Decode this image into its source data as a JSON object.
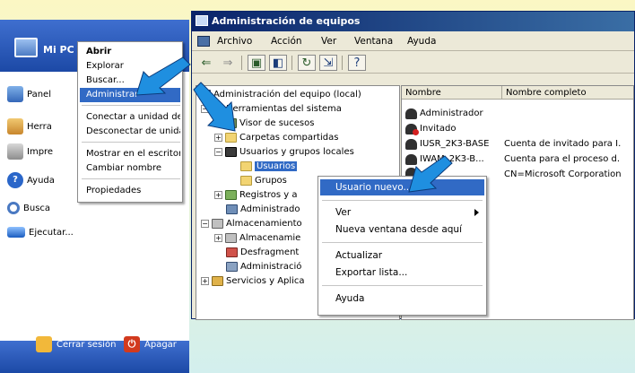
{
  "start_menu": {
    "user_label": "Mi PC",
    "items": [
      {
        "label": "Panel",
        "icon": "control-panel-icon"
      },
      {
        "label": "Herra",
        "icon": "tools-icon"
      },
      {
        "label": "Impre",
        "icon": "printer-icon"
      },
      {
        "label": "Ayuda",
        "icon": "help-icon"
      },
      {
        "label": "Busca",
        "icon": "search-icon"
      },
      {
        "label": "Ejecutar...",
        "icon": "run-icon"
      }
    ],
    "logoff_label": "Cerrar sesión",
    "shutdown_label": "Apagar"
  },
  "desktop_context_menu": {
    "items": [
      {
        "label": "Abrir",
        "bold": true
      },
      {
        "label": "Explorar"
      },
      {
        "label": "Buscar..."
      },
      {
        "label": "Administrar",
        "selected": true
      },
      {
        "label": "Conectar a unidad de red"
      },
      {
        "label": "Desconectar de unidad"
      },
      {
        "label": "Mostrar en el escritorio"
      },
      {
        "label": "Cambiar nombre"
      },
      {
        "label": "Propiedades"
      }
    ]
  },
  "window": {
    "title": "Administración de equipos",
    "menu": [
      "Archivo",
      "Acción",
      "Ver",
      "Ventana",
      "Ayuda"
    ],
    "toolbar": [
      "back-icon",
      "forward-icon",
      "up-folder-icon",
      "show-tree-icon",
      "refresh-icon",
      "export-icon",
      "help-icon"
    ],
    "tree": {
      "root": "Administración del equipo (local)",
      "system_tools": "Herramientas del sistema",
      "event_viewer": "Visor de sucesos",
      "shared_folders": "Carpetas compartidas",
      "local_users": "Usuarios y grupos locales",
      "users": "Usuarios",
      "groups": "Grupos",
      "logs": "Registros y a",
      "device_manager": "Administrado",
      "storage": "Almacenamiento",
      "removable_storage": "Almacenamie",
      "defrag": "Desfragment",
      "disk_mgmt": "Administració",
      "services": "Servicios y Aplica"
    },
    "list": {
      "columns": [
        "Nombre",
        "Nombre completo"
      ],
      "rows": [
        {
          "name": "Administrador",
          "full": "",
          "disabled": false
        },
        {
          "name": "Invitado",
          "full": "",
          "disabled": true
        },
        {
          "name": "IUSR_2K3-BASE",
          "full": "Cuenta de invitado para I.",
          "disabled": false
        },
        {
          "name": "IWAM_2K3-B...",
          "full": "Cuenta para el proceso d.",
          "disabled": false
        },
        {
          "name": "",
          "full": "CN=Microsoft Corporation",
          "disabled": false
        }
      ]
    }
  },
  "users_context_menu": {
    "new_user": "Usuario nuevo...",
    "view": "Ver",
    "new_window": "Nueva ventana desde aquí",
    "refresh": "Actualizar",
    "export": "Exportar lista...",
    "help": "Ayuda"
  },
  "colors": {
    "highlight": "#316ac5",
    "arrow": "#1f8fe0",
    "title_bar": "#0a246a"
  }
}
